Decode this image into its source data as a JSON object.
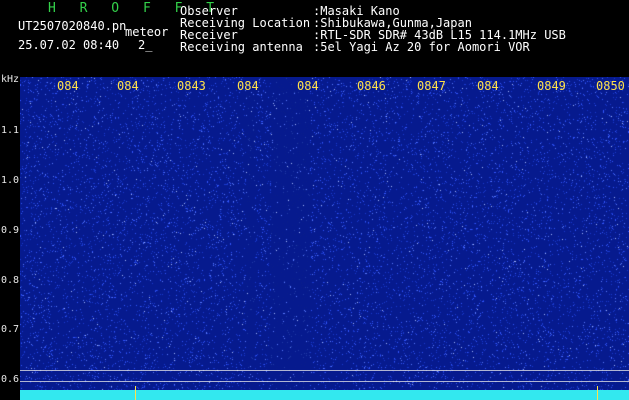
{
  "header": {
    "brand": "HROFFT",
    "filename": "UT2507020840.pn",
    "kind": "meteor",
    "datetime": "25.07.02 08:40",
    "count": "2_",
    "meta": [
      {
        "key": "Observer",
        "value": ":Masaki Kano"
      },
      {
        "key": "Receiving Location",
        "value": ":Shibukawa,Gunma,Japan"
      },
      {
        "key": "Receiver",
        "value": ":RTL-SDR SDR# 43dB L15 114.1MHz USB"
      },
      {
        "key": "Receiving antenna",
        "value": ":5el Yagi Az 20 for Aomori VOR"
      }
    ]
  },
  "y_axis": {
    "unit": "kHz",
    "ticks": [
      "1.1",
      "1.0",
      "0.9",
      "0.8",
      "0.7",
      "0.6"
    ]
  },
  "x_axis": {
    "labels": [
      "084",
      "084",
      "0843",
      "084",
      "084",
      "0846",
      "0847",
      "084",
      "0849",
      "0850"
    ]
  },
  "colors": {
    "background": "#000000",
    "waterfall_base": "#061a8e",
    "noise": "#5a7bff",
    "brand": "#33d14a",
    "time_labels": "#ffe14a",
    "spectrum": "#33e8ef"
  }
}
